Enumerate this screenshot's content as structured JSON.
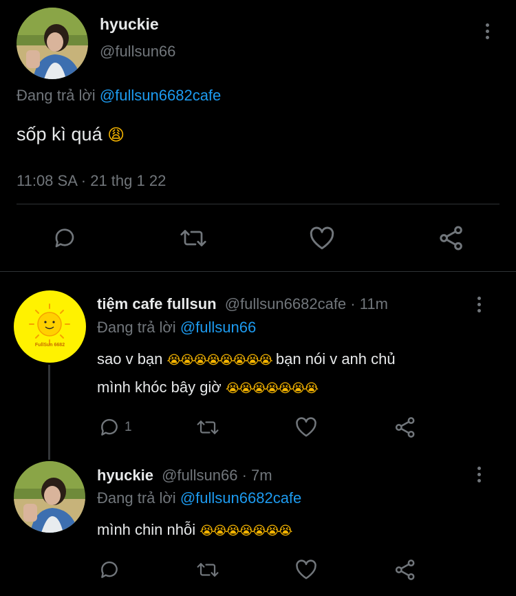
{
  "main_tweet": {
    "display_name": "hyuckie",
    "handle": "@fullsun66",
    "replying_label": "Đang trả lời",
    "replying_to": "@fullsun6682cafe",
    "text": "sốp kì quá",
    "emoji": "😩",
    "time": "11:08 SA · 21 thg 1 22"
  },
  "replies": [
    {
      "display_name": "tiệm cafe fullsun",
      "handle": "@fullsun6682cafe",
      "time": "· 11m",
      "replying_label": "Đang trả lời",
      "replying_to": "@fullsun66",
      "line1_a": "sao v bạn",
      "line1_emoji": "😭😭😭😭😭😭😭😭",
      "line1_b": "bạn nói v anh chủ",
      "line2_a": "mình khóc bây giờ",
      "line2_emoji": "😭😭😭😭😭😭😭",
      "reply_count": "1",
      "avatar_text": "FullSun 6682"
    },
    {
      "display_name": "hyuckie",
      "handle": "@fullsun66",
      "time": "· 7m",
      "replying_label": "Đang trả lời",
      "replying_to": "@fullsun6682cafe",
      "line1_a": "mình chin nhỗi",
      "line1_emoji": "😭😭😭😭😭😭😭"
    }
  ],
  "colors": {
    "background": "#000000",
    "text": "#e7e9ea",
    "muted": "#71767b",
    "link": "#1d9bf0",
    "sun_avatar_bg": "#fff200"
  }
}
